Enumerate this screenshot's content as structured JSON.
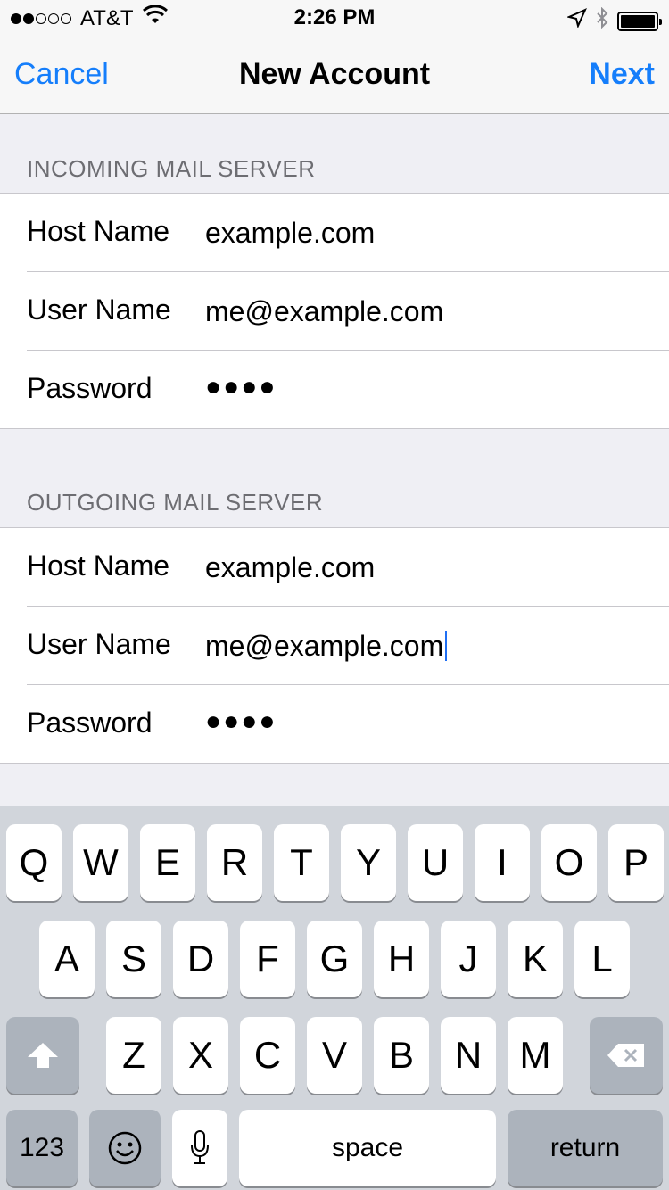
{
  "status_bar": {
    "carrier": "AT&T",
    "time": "2:26 PM",
    "icons": [
      "signal-dots",
      "wifi-icon",
      "location-arrow-icon",
      "bluetooth-icon",
      "battery-icon"
    ]
  },
  "nav": {
    "cancel": "Cancel",
    "title": "New Account",
    "next": "Next",
    "accent_color": "#157efb"
  },
  "incoming": {
    "header": "INCOMING MAIL SERVER",
    "rows": [
      {
        "label": "Host Name",
        "value": "example.com"
      },
      {
        "label": "User Name",
        "value": "me@example.com"
      },
      {
        "label": "Password",
        "value": "●●●●"
      }
    ]
  },
  "outgoing": {
    "header": "OUTGOING MAIL SERVER",
    "rows": [
      {
        "label": "Host Name",
        "value": "example.com"
      },
      {
        "label": "User Name",
        "value": "me@example.com"
      },
      {
        "label": "Password",
        "value": "●●●●"
      }
    ]
  },
  "keyboard": {
    "row1": [
      "Q",
      "W",
      "E",
      "R",
      "T",
      "Y",
      "U",
      "I",
      "O",
      "P"
    ],
    "row2": [
      "A",
      "S",
      "D",
      "F",
      "G",
      "H",
      "J",
      "K",
      "L"
    ],
    "row3": [
      "Z",
      "X",
      "C",
      "V",
      "B",
      "N",
      "M"
    ],
    "numbers": "123",
    "space": "space",
    "return": "return"
  }
}
